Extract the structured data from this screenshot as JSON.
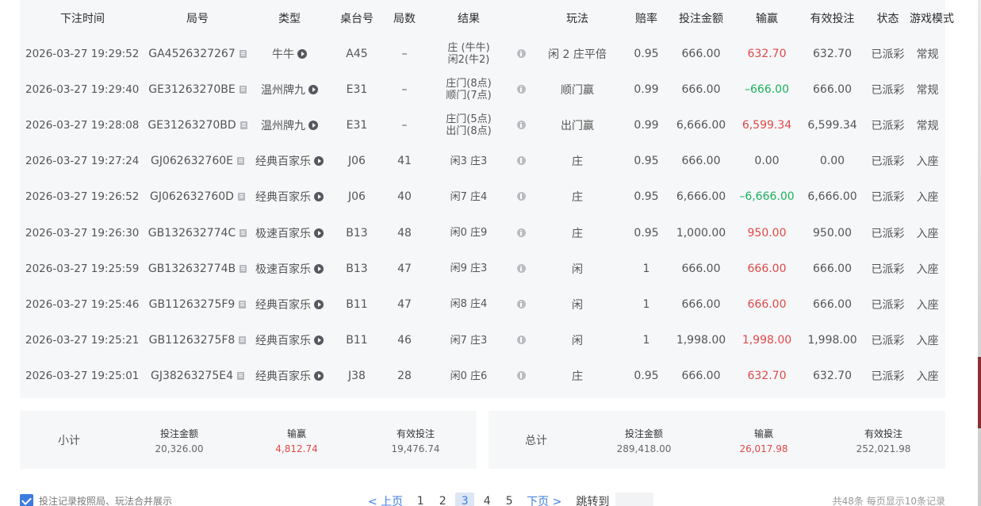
{
  "columns": [
    "下注时间",
    "局号",
    "类型",
    "桌台号",
    "局数",
    "结果",
    "",
    "玩法",
    "赔率",
    "投注金额",
    "输赢",
    "有效投注",
    "状态",
    "游戏模式"
  ],
  "rows": [
    {
      "time": "2026-03-27 19:29:52",
      "round": "GA4526327267",
      "type": "牛牛",
      "table": "A45",
      "count": "–",
      "result": [
        "庄 (牛牛)",
        "闲2(牛2)"
      ],
      "play": "闲 2 庄平倍",
      "odds": "0.95",
      "bet": "666.00",
      "win": "632.70",
      "win_color": "red",
      "valid": "632.70",
      "status": "已派彩",
      "mode": "常规"
    },
    {
      "time": "2026-03-27 19:29:40",
      "round": "GE31263270BE",
      "type": "温州牌九",
      "table": "E31",
      "count": "–",
      "result": [
        "庄门(8点)",
        "顺门(7点)"
      ],
      "play": "顺门赢",
      "odds": "0.99",
      "bet": "666.00",
      "win": "–666.00",
      "win_color": "green",
      "valid": "666.00",
      "status": "已派彩",
      "mode": "常规"
    },
    {
      "time": "2026-03-27 19:28:08",
      "round": "GE31263270BD",
      "type": "温州牌九",
      "table": "E31",
      "count": "–",
      "result": [
        "庄门(5点)",
        "出门(8点)"
      ],
      "play": "出门赢",
      "odds": "0.99",
      "bet": "6,666.00",
      "win": "6,599.34",
      "win_color": "red",
      "valid": "6,599.34",
      "status": "已派彩",
      "mode": "常规"
    },
    {
      "time": "2026-03-27 19:27:24",
      "round": "GJ062632760E",
      "type": "经典百家乐",
      "table": "J06",
      "count": "41",
      "result": [
        "闲3 庄3"
      ],
      "play": "庄",
      "odds": "0.95",
      "bet": "666.00",
      "win": "0.00",
      "win_color": "plain",
      "valid": "0.00",
      "status": "已派彩",
      "mode": "入座"
    },
    {
      "time": "2026-03-27 19:26:52",
      "round": "GJ062632760D",
      "type": "经典百家乐",
      "table": "J06",
      "count": "40",
      "result": [
        "闲7 庄4"
      ],
      "play": "庄",
      "odds": "0.95",
      "bet": "6,666.00",
      "win": "–6,666.00",
      "win_color": "green",
      "valid": "6,666.00",
      "status": "已派彩",
      "mode": "入座"
    },
    {
      "time": "2026-03-27 19:26:30",
      "round": "GB132632774C",
      "type": "极速百家乐",
      "table": "B13",
      "count": "48",
      "result": [
        "闲0 庄9"
      ],
      "play": "庄",
      "odds": "0.95",
      "bet": "1,000.00",
      "win": "950.00",
      "win_color": "red",
      "valid": "950.00",
      "status": "已派彩",
      "mode": "入座"
    },
    {
      "time": "2026-03-27 19:25:59",
      "round": "GB132632774B",
      "type": "极速百家乐",
      "table": "B13",
      "count": "47",
      "result": [
        "闲9 庄3"
      ],
      "play": "闲",
      "odds": "1",
      "bet": "666.00",
      "win": "666.00",
      "win_color": "red",
      "valid": "666.00",
      "status": "已派彩",
      "mode": "入座"
    },
    {
      "time": "2026-03-27 19:25:46",
      "round": "GB11263275F9",
      "type": "经典百家乐",
      "table": "B11",
      "count": "47",
      "result": [
        "闲8 庄4"
      ],
      "play": "闲",
      "odds": "1",
      "bet": "666.00",
      "win": "666.00",
      "win_color": "red",
      "valid": "666.00",
      "status": "已派彩",
      "mode": "入座"
    },
    {
      "time": "2026-03-27 19:25:21",
      "round": "GB11263275F8",
      "type": "经典百家乐",
      "table": "B11",
      "count": "46",
      "result": [
        "闲7 庄3"
      ],
      "play": "闲",
      "odds": "1",
      "bet": "1,998.00",
      "win": "1,998.00",
      "win_color": "red",
      "valid": "1,998.00",
      "status": "已派彩",
      "mode": "入座"
    },
    {
      "time": "2026-03-27 19:25:01",
      "round": "GJ38263275E4",
      "type": "经典百家乐",
      "table": "J38",
      "count": "28",
      "result": [
        "闲0 庄6"
      ],
      "play": "庄",
      "odds": "0.95",
      "bet": "666.00",
      "win": "632.70",
      "win_color": "red",
      "valid": "632.70",
      "status": "已派彩",
      "mode": "入座"
    }
  ],
  "subtotal": {
    "label": "小计",
    "bet_label": "投注金额",
    "bet": "20,326.00",
    "win_label": "输赢",
    "win": "4,812.74",
    "valid_label": "有效投注",
    "valid": "19,476.74"
  },
  "total": {
    "label": "总计",
    "bet_label": "投注金额",
    "bet": "289,418.00",
    "win_label": "输赢",
    "win": "26,017.98",
    "valid_label": "有效投注",
    "valid": "252,021.98"
  },
  "footer": {
    "merge_label": "投注记录按照局、玩法合并展示",
    "prev": "< 上页",
    "pages": [
      "1",
      "2",
      "3",
      "4",
      "5"
    ],
    "active_page": "3",
    "next": "下页 >",
    "jump_label": "跳转到",
    "count_info": "共48条  每页显示10条记录"
  },
  "colors": {
    "win_red": "#e14848",
    "loss_green": "#18b25b",
    "accent": "#3d7be0"
  }
}
